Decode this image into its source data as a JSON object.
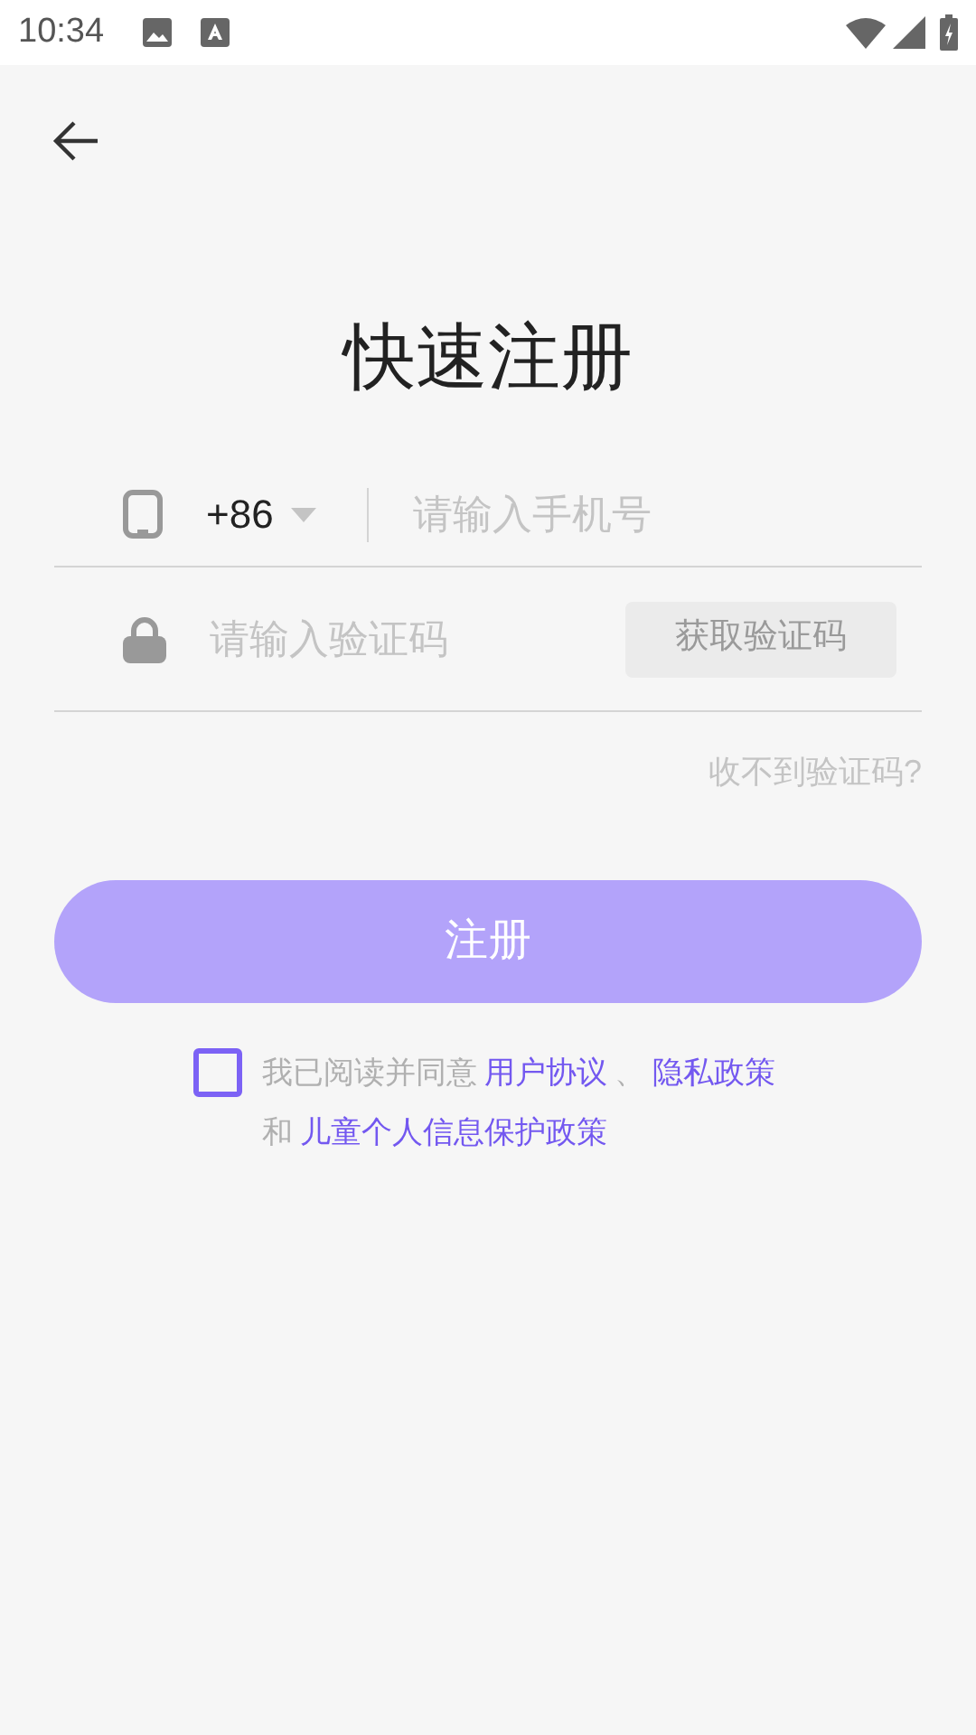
{
  "status_bar": {
    "time": "10:34"
  },
  "title": "快速注册",
  "phone": {
    "country_code": "+86",
    "placeholder": "请输入手机号"
  },
  "code": {
    "placeholder": "请输入验证码",
    "send_button": "获取验证码",
    "send_disabled": true
  },
  "help_link": "收不到验证码?",
  "register_button": {
    "label": "注册",
    "disabled": true
  },
  "agreement": {
    "checked": false,
    "lines": [
      [
        {
          "kind": "text",
          "text": "我已阅读并同意"
        },
        {
          "kind": "link",
          "text": "用户协议"
        },
        {
          "kind": "text",
          "text": "、"
        },
        {
          "kind": "link",
          "text": "隐私政策"
        }
      ],
      [
        {
          "kind": "text",
          "text": "和"
        },
        {
          "kind": "link",
          "text": "儿童个人信息保护政策"
        }
      ]
    ]
  }
}
